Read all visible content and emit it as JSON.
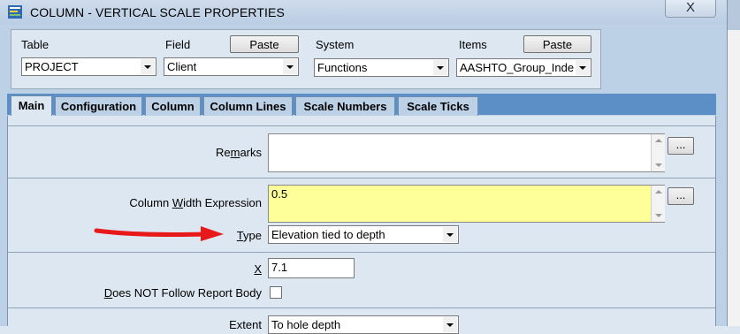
{
  "window": {
    "title": "COLUMN - VERTICAL SCALE PROPERTIES",
    "close_label": "X"
  },
  "top": {
    "table": {
      "label": "Table",
      "value": "PROJECT"
    },
    "field": {
      "label": "Field",
      "value": "Client",
      "paste_label": "Paste"
    },
    "system": {
      "label": "System",
      "value": "Functions"
    },
    "items": {
      "label": "Items",
      "value": "AASHTO_Group_Inde",
      "paste_label": "Paste"
    }
  },
  "tabs": [
    {
      "label": "Main",
      "active": true
    },
    {
      "label": "Configuration"
    },
    {
      "label": "Column"
    },
    {
      "label": "Column Lines"
    },
    {
      "label": "Scale Numbers"
    },
    {
      "label": "Scale Ticks"
    }
  ],
  "main": {
    "remarks": {
      "label_pre": "Re",
      "label_key": "m",
      "label_post": "arks",
      "value": "",
      "ellipsis": "..."
    },
    "width_expr": {
      "label_pre": "Column ",
      "label_key": "W",
      "label_post": "idth Expression",
      "value": "0.5",
      "ellipsis": "..."
    },
    "type": {
      "label_key": "T",
      "label_post": "ype",
      "value": "Elevation tied to depth"
    },
    "x": {
      "label_key": "X",
      "value": "7.1"
    },
    "follow": {
      "label_key": "D",
      "label_post": "oes NOT Follow Report Body",
      "checked": false
    },
    "extent": {
      "label": "Extent",
      "value": "To hole depth"
    }
  },
  "colors": {
    "accent_tab": "#5b8fc6",
    "highlight_field": "#ffff99",
    "arrow": "#e8191b"
  }
}
